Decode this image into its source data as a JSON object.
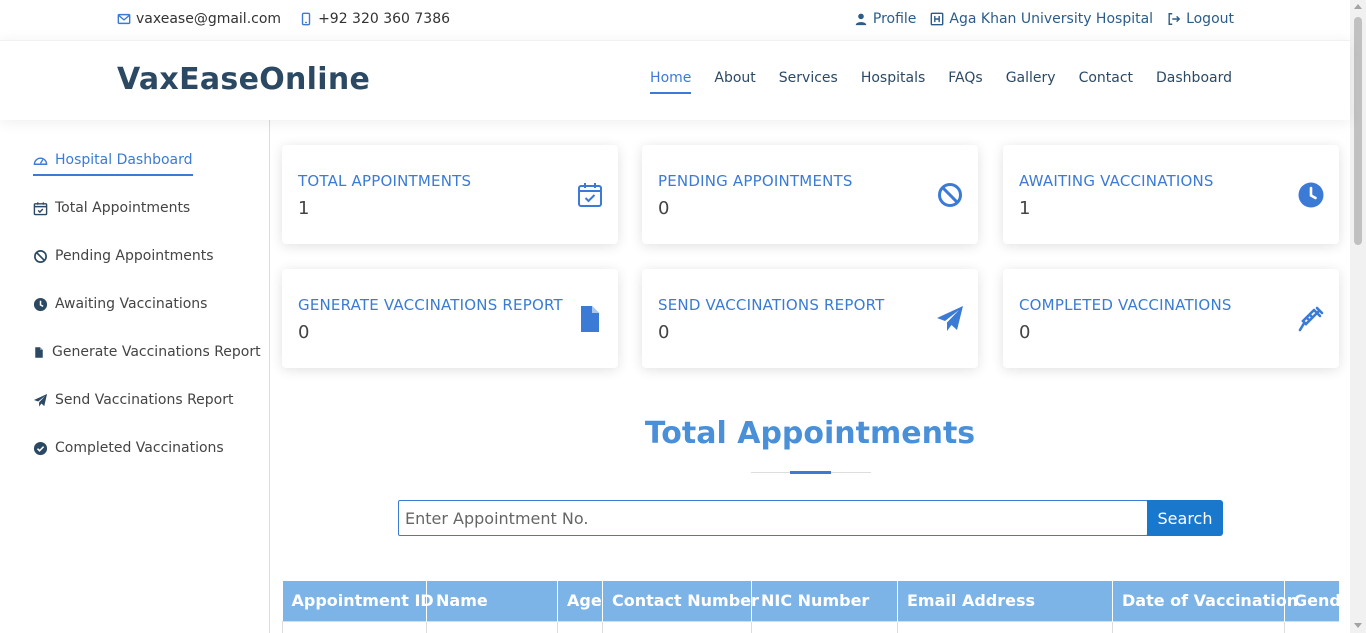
{
  "topbar": {
    "email": "vaxease@gmail.com",
    "phone": "+92 320 360 7386",
    "profile": "Profile",
    "hospital": "Aga Khan University Hospital",
    "logout": "Logout"
  },
  "header": {
    "logo": "VaxEaseOnline",
    "nav": [
      {
        "label": "Home",
        "active": true
      },
      {
        "label": "About"
      },
      {
        "label": "Services"
      },
      {
        "label": "Hospitals"
      },
      {
        "label": "FAQs"
      },
      {
        "label": "Gallery"
      },
      {
        "label": "Contact"
      },
      {
        "label": "Dashboard"
      }
    ]
  },
  "sidebar": {
    "items": [
      {
        "label": "Hospital Dashboard",
        "icon": "gauge-icon",
        "active": true
      },
      {
        "label": "Total Appointments",
        "icon": "calendar-check-icon"
      },
      {
        "label": "Pending Appointments",
        "icon": "ban-icon"
      },
      {
        "label": "Awaiting Vaccinations",
        "icon": "clock-icon"
      },
      {
        "label": "Generate Vaccinations Report",
        "icon": "file-icon"
      },
      {
        "label": "Send Vaccinations Report",
        "icon": "paper-plane-icon"
      },
      {
        "label": "Completed Vaccinations",
        "icon": "check-circle-icon"
      }
    ]
  },
  "cards": [
    {
      "title": "TOTAL APPOINTMENTS",
      "value": "1",
      "icon": "calendar-check-icon"
    },
    {
      "title": "PENDING APPOINTMENTS",
      "value": "0",
      "icon": "ban-icon"
    },
    {
      "title": "AWAITING VACCINATIONS",
      "value": "1",
      "icon": "clock-icon"
    },
    {
      "title": "GENERATE VACCINATIONS REPORT",
      "value": "0",
      "icon": "file-icon"
    },
    {
      "title": "SEND VACCINATIONS REPORT",
      "value": "0",
      "icon": "paper-plane-icon"
    },
    {
      "title": "COMPLETED VACCINATIONS",
      "value": "0",
      "icon": "syringe-icon"
    }
  ],
  "section": {
    "title": "Total Appointments",
    "search_placeholder": "Enter Appointment No.",
    "search_button": "Search"
  },
  "table": {
    "columns": [
      "Appointment ID",
      "Name",
      "Age",
      "Contact Number",
      "NIC Number",
      "Email Address",
      "Date of Vaccination",
      "Gender"
    ]
  },
  "colors": {
    "accent": "#3b7bd5",
    "dark": "#2c4964",
    "button": "#1977cc",
    "table_header": "#7db4e8"
  }
}
